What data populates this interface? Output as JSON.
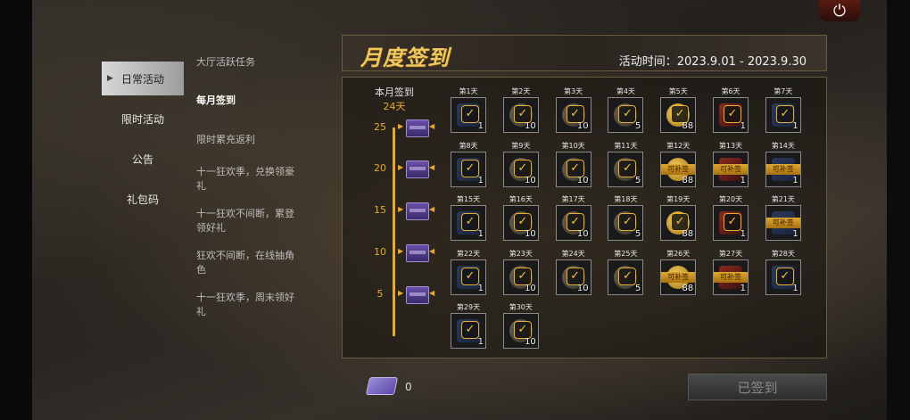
{
  "nav": {
    "items": [
      {
        "label": "日常活动",
        "active": true
      },
      {
        "label": "限时活动",
        "active": false
      },
      {
        "label": "公告",
        "active": false
      },
      {
        "label": "礼包码",
        "active": false
      }
    ]
  },
  "subnav": {
    "items": [
      {
        "label": "大厅活跃任务",
        "active": false
      },
      {
        "label": "每月签到",
        "active": true
      },
      {
        "label": "限时累充返利",
        "active": false
      },
      {
        "label": "十一狂欢季，兑换领豪礼",
        "active": false
      },
      {
        "label": "十一狂欢不间断，累登领好礼",
        "active": false
      },
      {
        "label": "狂欢不间断，在线抽角色",
        "active": false
      },
      {
        "label": "十一狂欢季，周末领好礼",
        "active": false
      }
    ]
  },
  "header": {
    "title": "月度签到",
    "time": "活动时间：2023.9.01 - 2023.9.30"
  },
  "progress": {
    "label": "本月签到",
    "days": "24天",
    "milestones": [
      "25",
      "20",
      "15",
      "10",
      "5"
    ]
  },
  "days": [
    {
      "label": "第1天",
      "count": "1",
      "type": "box",
      "checked": true,
      "ribbon": ""
    },
    {
      "label": "第2天",
      "count": "10",
      "type": "bag",
      "checked": true,
      "ribbon": ""
    },
    {
      "label": "第3天",
      "count": "10",
      "type": "bag",
      "checked": true,
      "ribbon": ""
    },
    {
      "label": "第4天",
      "count": "5",
      "type": "bag",
      "checked": true,
      "ribbon": ""
    },
    {
      "label": "第5天",
      "count": "88",
      "type": "gold",
      "checked": true,
      "ribbon": ""
    },
    {
      "label": "第6天",
      "count": "1",
      "type": "red",
      "checked": true,
      "ribbon": ""
    },
    {
      "label": "第7天",
      "count": "1",
      "type": "box",
      "checked": true,
      "ribbon": ""
    },
    {
      "label": "第8天",
      "count": "1",
      "type": "box",
      "checked": true,
      "ribbon": ""
    },
    {
      "label": "第9天",
      "count": "10",
      "type": "bag",
      "checked": true,
      "ribbon": ""
    },
    {
      "label": "第10天",
      "count": "10",
      "type": "bag",
      "checked": true,
      "ribbon": ""
    },
    {
      "label": "第11天",
      "count": "5",
      "type": "bag",
      "checked": true,
      "ribbon": ""
    },
    {
      "label": "第12天",
      "count": "88",
      "type": "gold",
      "checked": false,
      "ribbon": "可补签"
    },
    {
      "label": "第13天",
      "count": "1",
      "type": "red",
      "checked": false,
      "ribbon": "可补签"
    },
    {
      "label": "第14天",
      "count": "1",
      "type": "box",
      "checked": false,
      "ribbon": "可补签"
    },
    {
      "label": "第15天",
      "count": "1",
      "type": "box",
      "checked": true,
      "ribbon": ""
    },
    {
      "label": "第16天",
      "count": "10",
      "type": "bag",
      "checked": true,
      "ribbon": ""
    },
    {
      "label": "第17天",
      "count": "10",
      "type": "bag",
      "checked": true,
      "ribbon": ""
    },
    {
      "label": "第18天",
      "count": "5",
      "type": "bag",
      "checked": true,
      "ribbon": ""
    },
    {
      "label": "第19天",
      "count": "88",
      "type": "gold",
      "checked": true,
      "ribbon": ""
    },
    {
      "label": "第20天",
      "count": "1",
      "type": "red",
      "checked": true,
      "ribbon": ""
    },
    {
      "label": "第21天",
      "count": "1",
      "type": "box",
      "checked": false,
      "ribbon": "可补签"
    },
    {
      "label": "第22天",
      "count": "1",
      "type": "box",
      "checked": true,
      "ribbon": ""
    },
    {
      "label": "第23天",
      "count": "10",
      "type": "bag",
      "checked": true,
      "ribbon": ""
    },
    {
      "label": "第24天",
      "count": "10",
      "type": "bag",
      "checked": true,
      "ribbon": ""
    },
    {
      "label": "第25天",
      "count": "5",
      "type": "bag",
      "checked": true,
      "ribbon": ""
    },
    {
      "label": "第26天",
      "count": "88",
      "type": "gold",
      "checked": false,
      "ribbon": "可补签"
    },
    {
      "label": "第27天",
      "count": "1",
      "type": "red",
      "checked": false,
      "ribbon": "可补签"
    },
    {
      "label": "第28天",
      "count": "1",
      "type": "box",
      "checked": true,
      "ribbon": ""
    },
    {
      "label": "第29天",
      "count": "1",
      "type": "box",
      "checked": true,
      "ribbon": ""
    },
    {
      "label": "第30天",
      "count": "10",
      "type": "bag",
      "checked": true,
      "ribbon": ""
    }
  ],
  "footer": {
    "card_count": "0",
    "signed_label": "已签到"
  },
  "icons": {
    "power": "power-icon",
    "check": "checkmark-icon",
    "card": "resign-card-icon",
    "chest": "chest-icon"
  }
}
